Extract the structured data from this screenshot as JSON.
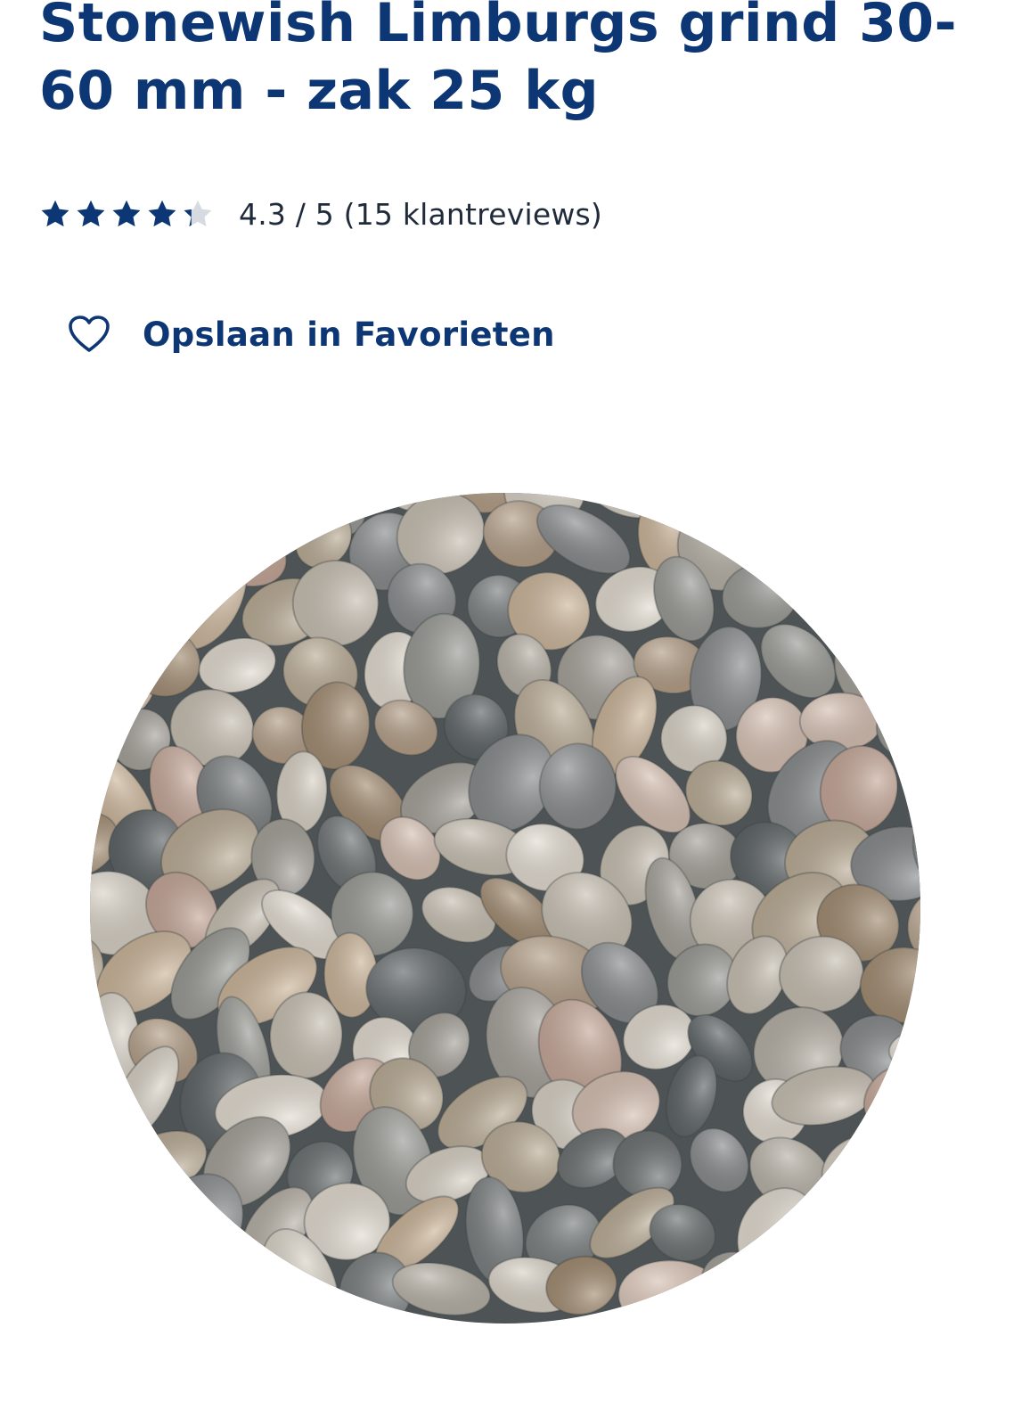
{
  "product": {
    "title": "Stonewish Limburgs grind 30-60 mm - zak 25 kg"
  },
  "rating": {
    "score": 4.3,
    "max": 5,
    "text": "4.3 / 5 (15 klantreviews)",
    "star_color": "#0d3674",
    "empty_star_color": "#d6dbe1"
  },
  "favorite": {
    "label": "Opslaan in Favorieten",
    "icon": "heart-outline-icon"
  },
  "image": {
    "description": "round pebble gravel"
  }
}
